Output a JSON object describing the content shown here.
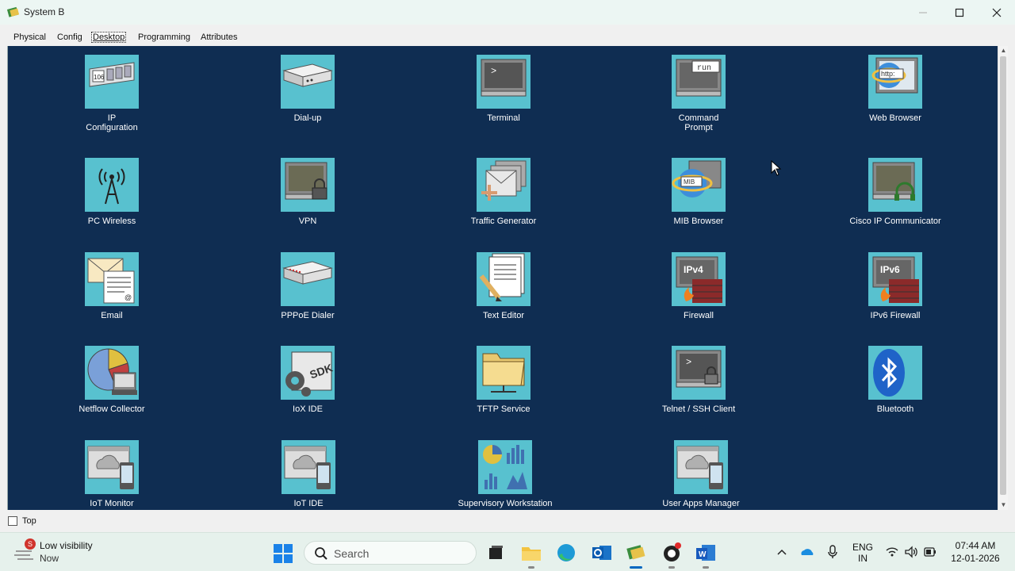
{
  "window": {
    "title": "System B",
    "controls": [
      "minimize",
      "maximize",
      "close"
    ]
  },
  "tabs": [
    {
      "label": "Physical",
      "active": false
    },
    {
      "label": "Config",
      "active": false
    },
    {
      "label": "Desktop",
      "active": true
    },
    {
      "label": "Programming",
      "active": false
    },
    {
      "label": "Attributes",
      "active": false
    }
  ],
  "apps": [
    {
      "label": "IP\nConfiguration",
      "icon": "ip-config-icon"
    },
    {
      "label": "Dial-up",
      "icon": "dialup-icon"
    },
    {
      "label": "Terminal",
      "icon": "terminal-icon"
    },
    {
      "label": "Command\nPrompt",
      "icon": "command-prompt-icon"
    },
    {
      "label": "Web Browser",
      "icon": "web-browser-icon"
    },
    {
      "label": "PC Wireless",
      "icon": "pc-wireless-icon"
    },
    {
      "label": "VPN",
      "icon": "vpn-icon"
    },
    {
      "label": "Traffic Generator",
      "icon": "traffic-generator-icon"
    },
    {
      "label": "MIB Browser",
      "icon": "mib-browser-icon"
    },
    {
      "label": "Cisco IP Communicator",
      "icon": "ip-communicator-icon"
    },
    {
      "label": "Email",
      "icon": "email-icon"
    },
    {
      "label": "PPPoE Dialer",
      "icon": "pppoe-dialer-icon"
    },
    {
      "label": "Text Editor",
      "icon": "text-editor-icon"
    },
    {
      "label": "Firewall",
      "icon": "firewall-icon"
    },
    {
      "label": "IPv6 Firewall",
      "icon": "ipv6-firewall-icon"
    },
    {
      "label": "Netflow Collector",
      "icon": "netflow-collector-icon"
    },
    {
      "label": "IoX IDE",
      "icon": "iox-ide-icon"
    },
    {
      "label": "TFTP Service",
      "icon": "tftp-service-icon"
    },
    {
      "label": "Telnet / SSH Client",
      "icon": "telnet-ssh-icon"
    },
    {
      "label": "Bluetooth",
      "icon": "bluetooth-icon"
    },
    {
      "label": "IoT Monitor",
      "icon": "iot-monitor-icon"
    },
    {
      "label": "IoT IDE",
      "icon": "iot-ide-icon"
    },
    {
      "label": "Supervisory Workstation",
      "icon": "supervisory-workstation-icon"
    },
    {
      "label": "User Apps Manager",
      "icon": "user-apps-manager-icon"
    }
  ],
  "icon_text": {
    "ip_config": "106",
    "command": "run",
    "browser": "http:",
    "mib": "MIB",
    "ipv4": "IPv4",
    "ipv6": "IPv6",
    "sdk": "SDK"
  },
  "bottom": {
    "checkbox_label": "Top",
    "checked": false
  },
  "taskbar": {
    "weather_title": "Low visibility",
    "weather_sub": "Now",
    "weather_badge": "S",
    "search_placeholder": "Search",
    "lang_line1": "ENG",
    "lang_line2": "IN",
    "time": "07:44 AM",
    "date": "12-01-2026"
  },
  "colors": {
    "desktop_bg": "#0f2d52",
    "tile_bg": "#58c1cf",
    "accent": "#0067c0"
  }
}
